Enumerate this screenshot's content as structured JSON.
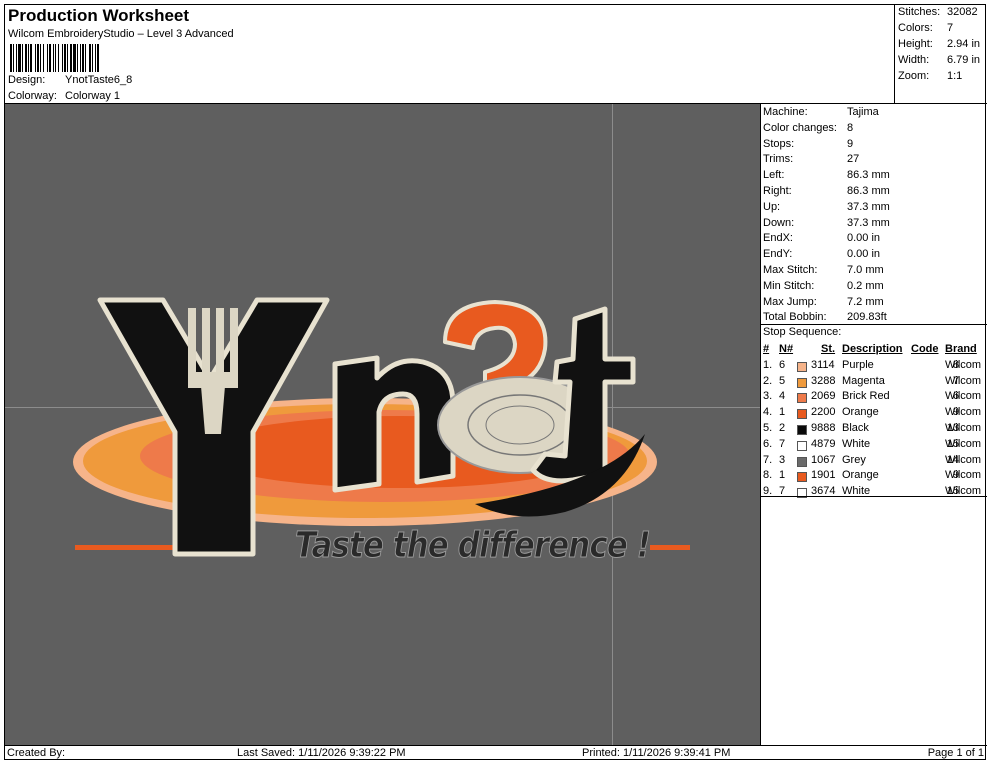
{
  "header": {
    "title": "Production Worksheet",
    "subtitle": "Wilcom EmbroideryStudio – Level 3 Advanced",
    "design_label": "Design:",
    "design_value": "YnotTaste6_8",
    "colorway_label": "Colorway:",
    "colorway_value": "Colorway 1"
  },
  "stats": [
    {
      "label": "Stitches:",
      "value": "32082"
    },
    {
      "label": "Colors:",
      "value": "7"
    },
    {
      "label": "Height:",
      "value": "2.94 in"
    },
    {
      "label": "Width:",
      "value": "6.79 in"
    },
    {
      "label": "Zoom:",
      "value": "1:1"
    }
  ],
  "machine_info": [
    {
      "label": "Machine:",
      "value": "Tajima"
    },
    {
      "label": "Color changes:",
      "value": "8"
    },
    {
      "label": "Stops:",
      "value": "9"
    },
    {
      "label": "Trims:",
      "value": "27"
    },
    {
      "label": "Left:",
      "value": "86.3 mm"
    },
    {
      "label": "Right:",
      "value": "86.3 mm"
    },
    {
      "label": "Up:",
      "value": "37.3 mm"
    },
    {
      "label": "Down:",
      "value": "37.3 mm"
    },
    {
      "label": "EndX:",
      "value": "0.00 in"
    },
    {
      "label": "EndY:",
      "value": "0.00 in"
    },
    {
      "label": "Max Stitch:",
      "value": "7.0 mm"
    },
    {
      "label": "Min Stitch:",
      "value": "0.2 mm"
    },
    {
      "label": "Max Jump:",
      "value": "7.2 mm"
    },
    {
      "label": "Total Bobbin:",
      "value": "209.83ft"
    }
  ],
  "stop_sequence": {
    "title": "Stop Sequence:",
    "headers": {
      "idx": "#",
      "n": "N#",
      "st": "St.",
      "desc": "Description",
      "code": "Code",
      "brand": "Brand"
    },
    "rows": [
      {
        "idx": "1.",
        "n": "6",
        "color": "#f6b48a",
        "st": "3114",
        "desc": "Purple",
        "code": "8",
        "brand": "Wilcom"
      },
      {
        "idx": "2.",
        "n": "5",
        "color": "#ef9a3c",
        "st": "3288",
        "desc": "Magenta",
        "code": "7",
        "brand": "Wilcom"
      },
      {
        "idx": "3.",
        "n": "4",
        "color": "#ee7a4a",
        "st": "2069",
        "desc": "Brick Red",
        "code": "6",
        "brand": "Wilcom"
      },
      {
        "idx": "4.",
        "n": "1",
        "color": "#e85a1f",
        "st": "2200",
        "desc": "Orange",
        "code": "9",
        "brand": "Wilcom"
      },
      {
        "idx": "5.",
        "n": "2",
        "color": "#0a0a0a",
        "st": "9888",
        "desc": "Black",
        "code": "13",
        "brand": "Wilcom"
      },
      {
        "idx": "6.",
        "n": "7",
        "color": "#ffffff",
        "st": "4879",
        "desc": "White",
        "code": "15",
        "brand": "Wilcom"
      },
      {
        "idx": "7.",
        "n": "3",
        "color": "#6a6a6a",
        "st": "1067",
        "desc": "Grey",
        "code": "14",
        "brand": "Wilcom"
      },
      {
        "idx": "8.",
        "n": "1",
        "color": "#e85a1f",
        "st": "1901",
        "desc": "Orange",
        "code": "9",
        "brand": "Wilcom"
      },
      {
        "idx": "9.",
        "n": "7",
        "color": "#ffffff",
        "st": "3674",
        "desc": "White",
        "code": "15",
        "brand": "Wilcom"
      }
    ]
  },
  "design_art": {
    "letters": [
      "Y",
      "n",
      "t"
    ],
    "tagline": "Taste the difference !"
  },
  "footer": {
    "created_by": "Created By:",
    "last_saved": "Last Saved: 1/11/2026 9:39:22 PM",
    "printed": "Printed: 1/11/2026 9:39:41 PM",
    "page": "Page 1 of 1"
  }
}
